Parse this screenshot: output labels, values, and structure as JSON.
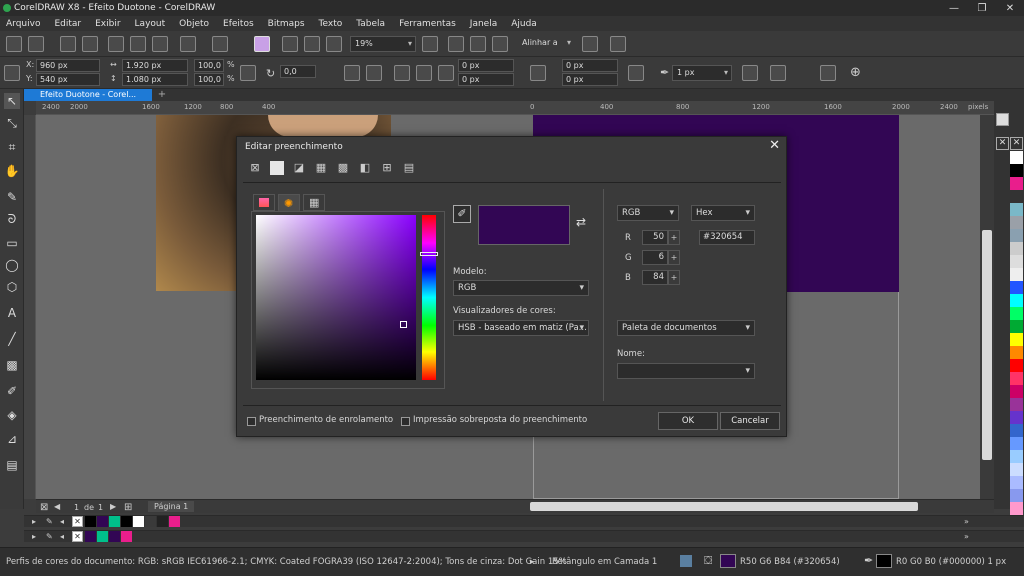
{
  "window": {
    "title": "CorelDRAW X8 - Efeito Duotone - CorelDRAW",
    "controls": [
      "—",
      "❐",
      "✕"
    ]
  },
  "menu": [
    "Arquivo",
    "Editar",
    "Exibir",
    "Layout",
    "Objeto",
    "Efeitos",
    "Bitmaps",
    "Texto",
    "Tabela",
    "Ferramentas",
    "Janela",
    "Ajuda"
  ],
  "toolbar": {
    "zoom": "19%",
    "align_label": "Alinhar a"
  },
  "property_bar": {
    "x_label": "X:",
    "x_value": "960 px",
    "y_label": "Y:",
    "y_value": "540 px",
    "w_value": "1.920 px",
    "h_value": "1.080 px",
    "scale_w": "100,0",
    "scale_h": "100,0",
    "pct": "%",
    "rotation": "0,0",
    "corner1": "0 px",
    "corner2": "0 px",
    "corner3": "0 px",
    "corner4": "0 px",
    "outline_width": "1 px"
  },
  "doc_tab": {
    "label": "Efeito Duotone - Corel...",
    "plus": "+"
  },
  "ruler": {
    "ticks": [
      "2400",
      "2000",
      "1600",
      "1200",
      "800",
      "400",
      "0",
      "400",
      "800",
      "1200",
      "1600",
      "2000",
      "2400",
      "pixels"
    ]
  },
  "page_nav": {
    "current": "1",
    "of": "de",
    "total": "1",
    "page_tab": "Página 1"
  },
  "status": {
    "color_profile": "Perfis de cores do documento: RGB: sRGB IEC61966-2.1; CMYK: Coated FOGRA39 (ISO 12647-2:2004); Tons de cinza: Dot Gain 15%",
    "selection": "Retângulo em Camada 1",
    "fill_readout": "R50 G6 B84 (#320654)",
    "outline_readout": "R0 G0 B0 (#000000)  1 px",
    "fill_color": "#320654",
    "outline_color": "#000000"
  },
  "dialog": {
    "title": "Editar preenchimento",
    "close": "✕",
    "model_label": "Modelo:",
    "model_value": "RGB",
    "viewer_label": "Visualizadores de cores:",
    "viewer_value": "HSB - baseado em matiz (Pa...",
    "color_space": "RGB",
    "code_format": "Hex",
    "r_label": "R",
    "r_value": "50",
    "g_label": "G",
    "g_value": "6",
    "b_label": "B",
    "b_value": "84",
    "hex_value": "#320654",
    "palette_value": "Paleta de documentos",
    "name_label": "Nome:",
    "name_value": "",
    "wrap_fill": "Preenchimento de enrolamento",
    "overprint": "Impressão sobreposta do preenchimento",
    "ok": "OK",
    "cancel": "Cancelar",
    "current_color": "#320654"
  },
  "palette": {
    "right": [
      "#ffffff",
      "#000000",
      "#e91e8c",
      "#333333",
      "#7ab8c8",
      "#9aa0a8",
      "#8aa0b0",
      "#cccccc",
      "#dddddd",
      "#eeeeee",
      "#2255ff",
      "#00ffff",
      "#00ff66",
      "#00aa33",
      "#ffff00",
      "#ff8800",
      "#ff0000",
      "#ff3366",
      "#cc0066",
      "#993399",
      "#6633cc",
      "#3366cc",
      "#6699ff",
      "#99ccff",
      "#ccddff",
      "#aabbff",
      "#8899ee",
      "#ff99cc"
    ],
    "strip1": [
      "#000000",
      "#320654",
      "#00c08b",
      "#000000",
      "#ffffff",
      "#3a3a3a",
      "#222222",
      "#e91e8c"
    ],
    "strip2": [
      "#320654",
      "#00c08b",
      "#320654",
      "#e91e8c"
    ]
  }
}
